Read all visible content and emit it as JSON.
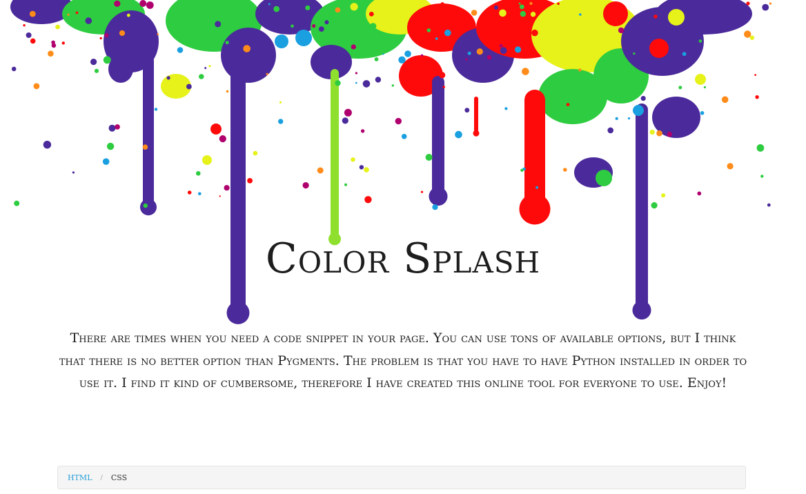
{
  "page": {
    "title": "Color Splash",
    "intro": "There are times when you need a code snippet in your page. You can use tons of available options, but I think that there is no better option than Pygments. The problem is that you have to have Python installed in order to use it. I find it kind of cumbersome, therefore I have created this online tool for everyone to use. Enjoy!"
  },
  "breadcrumb": {
    "items": [
      {
        "label": "HTML",
        "active": false
      },
      {
        "label": "CSS",
        "active": true
      }
    ],
    "separator": "/"
  },
  "colors": {
    "purple": "#4b2a9b",
    "green": "#2ecc40",
    "red": "#ff0a0a",
    "yellow": "#e6f21a",
    "lime": "#8fe02e",
    "link": "#2a9fd6"
  }
}
